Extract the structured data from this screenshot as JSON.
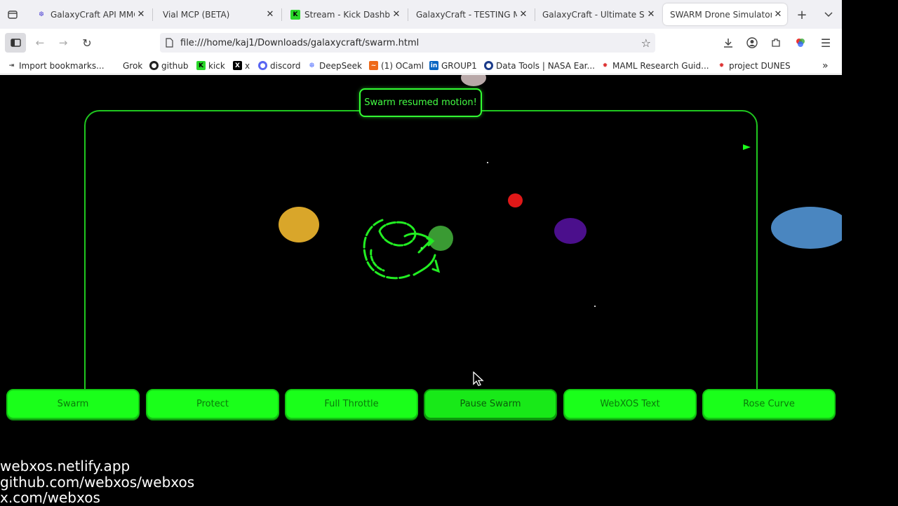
{
  "tabs": [
    {
      "title": "GalaxyCraft API MMO l",
      "icon": "galaxycraft-icon"
    },
    {
      "title": "Vial MCP (BETA)",
      "icon": ""
    },
    {
      "title": "Stream - Kick Dashboa",
      "icon": "kick-icon"
    },
    {
      "title": "GalaxyCraft - TESTING MO",
      "icon": ""
    },
    {
      "title": "GalaxyCraft - Ultimate Spa",
      "icon": ""
    },
    {
      "title": "SWARM Drone Simulator |",
      "icon": ""
    }
  ],
  "url": "file:///home/kaj1/Downloads/galaxycraft/swarm.html",
  "bookmarks": [
    {
      "label": "Import bookmarks...",
      "icon": "import-icon"
    },
    {
      "label": "Grok",
      "icon": ""
    },
    {
      "label": "github",
      "icon": "github-icon"
    },
    {
      "label": "kick",
      "icon": "kick-icon"
    },
    {
      "label": "x",
      "icon": "x-icon"
    },
    {
      "label": "discord",
      "icon": "discord-icon"
    },
    {
      "label": "DeepSeek",
      "icon": "deepseek-icon"
    },
    {
      "label": "(1) OCaml",
      "icon": "ocaml-icon"
    },
    {
      "label": "GROUP1",
      "icon": "linkedin-icon"
    },
    {
      "label": "Data Tools | NASA Ear...",
      "icon": "nasa-icon"
    },
    {
      "label": "MAML Research Guid...",
      "icon": "maml-icon"
    },
    {
      "label": "project DUNES",
      "icon": "dunes-icon"
    }
  ],
  "toast": "Swarm resumed motion!",
  "controls": [
    {
      "label": "Swarm"
    },
    {
      "label": "Protect"
    },
    {
      "label": "Full Throttle"
    },
    {
      "label": "Pause Swarm"
    },
    {
      "label": "WebXOS Text"
    },
    {
      "label": "Rose Curve"
    }
  ],
  "footer": [
    "webxos.netlify.app",
    "github.com/webxos/webxos",
    "x.com/webxos"
  ],
  "colors": {
    "accent": "#1aff1a",
    "frame": "#1fc71f",
    "planet_yellow": "#d9a62a",
    "planet_green": "#3a9a33",
    "planet_red": "#e01818",
    "planet_purple": "#4b0f8c",
    "planet_blue": "#4a86c0"
  }
}
